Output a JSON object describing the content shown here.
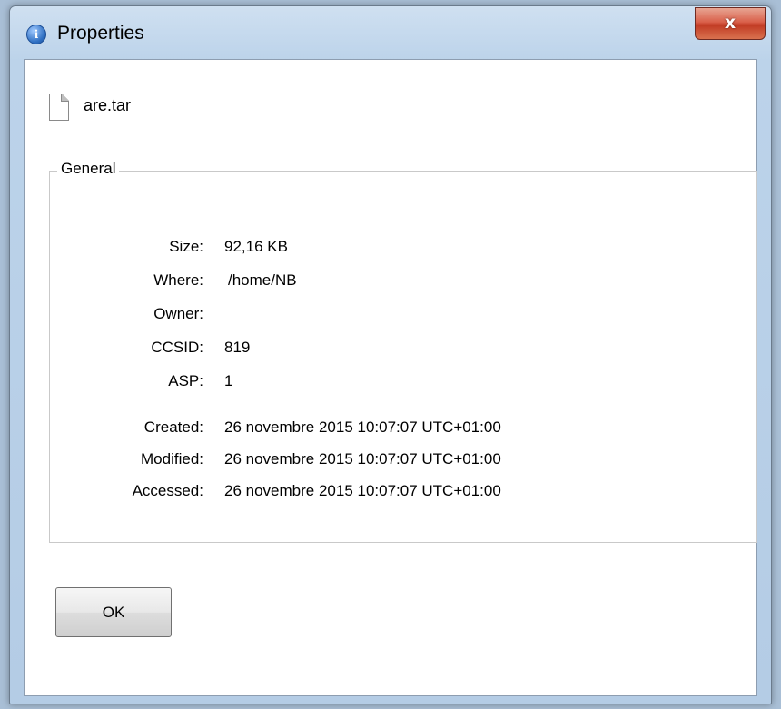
{
  "window": {
    "title": "Properties",
    "close_label": "x",
    "title_icon_glyph": "i"
  },
  "file": {
    "name": "are.tar"
  },
  "general": {
    "legend": "General",
    "size_label": "Size:",
    "size_value": "92,16 KB",
    "where_label": "Where:",
    "where_value": "/home/NB",
    "owner_label": "Owner:",
    "owner_value": "",
    "ccsid_label": "CCSID:",
    "ccsid_value": "819",
    "asp_label": "ASP:",
    "asp_value": "1",
    "created_label": "Created:",
    "created_value": "26 novembre 2015 10:07:07 UTC+01:00",
    "modified_label": "Modified:",
    "modified_value": "26 novembre 2015 10:07:07 UTC+01:00",
    "accessed_label": "Accessed:",
    "accessed_value": "26 novembre 2015 10:07:07 UTC+01:00"
  },
  "buttons": {
    "ok_label": "OK"
  },
  "icons": {
    "title": "info-icon",
    "close": "close-icon",
    "file": "file-icon"
  },
  "colors": {
    "titlebar": "#bcd3ea",
    "close_button": "#c13b24",
    "client_background": "#ffffff"
  }
}
